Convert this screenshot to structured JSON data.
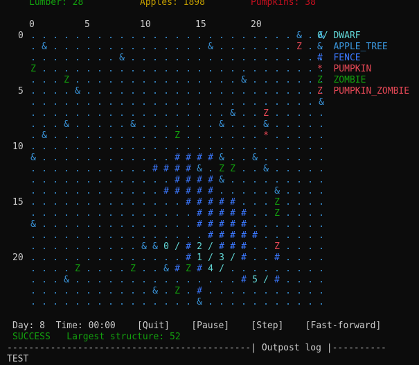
{
  "stats": {
    "lumber": "Lumber: 28",
    "apples": "Apples: 1898",
    "pumpkins": "Pumpkins: 38"
  },
  "x_ticks": [
    "0",
    "5",
    "10",
    "15",
    "20"
  ],
  "y_ticks": [
    "0",
    "5",
    "10",
    "15",
    "20"
  ],
  "grid": [
    "........................&.&",
    ".&..............&.......Z..",
    "........&..................",
    "Z..........................",
    "...Z...............&.......",
    "....&......................",
    "..........................&",
    "..................&..Z.....",
    "...&.....&.......&...&.....",
    ".&...........Z.......*.....",
    "...........................",
    "&............####&..&......",
    "...........####&.ZZ..&.....",
    ".............####&.........",
    "............#####.....&....",
    "..............#####...Z....",
    "...............#####..Z....",
    "&..............#####.......",
    "................#####......",
    "..........&&0/#2/###..Z....",
    "..............#1/3/#..#....",
    "....Z....Z..&#Z#4/.........",
    "...&...............#5/#....",
    "...........&.Z.#...........",
    "...............&..........."
  ],
  "legend": [
    {
      "symbol": "0/",
      "label": "DWARF",
      "color": "#61d6d6"
    },
    {
      "symbol": "&",
      "label": "APPLE_TREE",
      "color": "#3a96dd"
    },
    {
      "symbol": "#",
      "label": "FENCE",
      "color": "#3b78ff"
    },
    {
      "symbol": "*",
      "label": "PUMPKIN",
      "color": "#e74856"
    },
    {
      "symbol": "Z",
      "label": "ZOMBIE",
      "color": "#13a10e"
    },
    {
      "symbol": "Z",
      "label": "PUMPKIN_ZOMBIE",
      "color": "#e74856"
    }
  ],
  "pumpkin_zombie_cells": [
    [
      1,
      24
    ],
    [
      7,
      21
    ],
    [
      9,
      12
    ],
    [
      19,
      22
    ]
  ],
  "status": {
    "day": "Day: 8",
    "time": "Time: 00:00",
    "quit": "[Quit]",
    "pause": "[Pause]",
    "step": "[Step]",
    "fast_forward": "[Fast-forward]",
    "result": "SUCCESS",
    "largest_structure": "Largest structure: 52"
  },
  "log": {
    "separator": "---------------------------------------------| Outpost log |----------",
    "first_line": "TEST"
  }
}
